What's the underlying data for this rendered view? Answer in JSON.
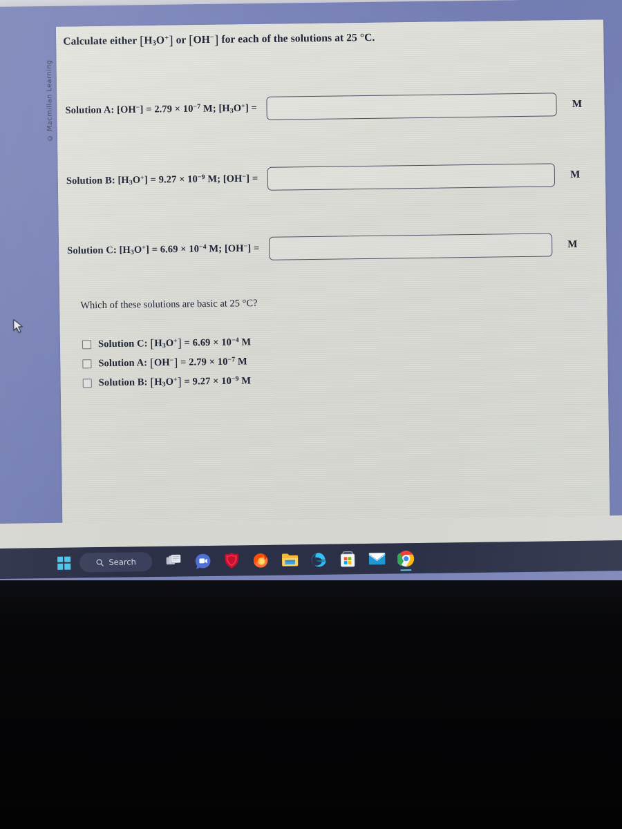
{
  "meta": {
    "copyright": "© Macmillan Learning"
  },
  "prompt": {
    "lead": "Calculate either",
    "species_1": "H3O+",
    "conjunction": "or",
    "species_2": "OH−",
    "tail": "for each of the solutions at 25 °C.",
    "full_text": "Calculate either [H3O+] or [OH−] for each of the solutions at 25 °C."
  },
  "solutions": [
    {
      "id": "A",
      "label_prefix": "Solution A:",
      "given_species": "OH−",
      "given_coefficient": "2.79",
      "given_exponent": "−7",
      "given_unit": "M",
      "asked_species": "H3O+",
      "full_label": "Solution A: [OH−] = 2.79 × 10−7 M; [H3O+] =",
      "input_value": "",
      "input_placeholder": "",
      "unit": "M"
    },
    {
      "id": "B",
      "label_prefix": "Solution B:",
      "given_species": "H3O+",
      "given_coefficient": "9.27",
      "given_exponent": "−9",
      "given_unit": "M",
      "asked_species": "OH−",
      "full_label": "Solution B: [H3O+] = 9.27 × 10−9 M; [OH−] =",
      "input_value": "",
      "input_placeholder": "",
      "unit": "M"
    },
    {
      "id": "C",
      "label_prefix": "Solution C:",
      "given_species": "H3O+",
      "given_coefficient": "6.69",
      "given_exponent": "−4",
      "given_unit": "M",
      "asked_species": "OH−",
      "full_label": "Solution C: [H3O+] = 6.69 × 10−4 M; [OH−] =",
      "input_value": "",
      "input_placeholder": "",
      "unit": "M"
    }
  ],
  "sub_question": {
    "text": "Which of these solutions are basic at 25 °C?"
  },
  "options": [
    {
      "id": "C",
      "prefix": "Solution C:",
      "species": "H3O+",
      "coefficient": "6.69",
      "exponent": "−4",
      "unit": "M",
      "checked": false,
      "full_text": "Solution C: [H3O+] = 6.69 × 10−4 M"
    },
    {
      "id": "A",
      "prefix": "Solution A:",
      "species": "OH−",
      "coefficient": "2.79",
      "exponent": "−7",
      "unit": "M",
      "checked": false,
      "full_text": "Solution A: [OH−] = 2.79 × 10−7 M"
    },
    {
      "id": "B",
      "prefix": "Solution B:",
      "species": "H3O+",
      "coefficient": "9.27",
      "exponent": "−9",
      "unit": "M",
      "checked": false,
      "full_text": "Solution B: [H3O+] = 9.27 × 10−9 M"
    }
  ],
  "taskbar": {
    "search_label": "Search",
    "items": [
      {
        "name": "start-button",
        "icon": "windows-logo-icon"
      },
      {
        "name": "search-box",
        "icon": "search-icon"
      },
      {
        "name": "task-view-button",
        "icon": "task-view-icon"
      },
      {
        "name": "google-meet-button",
        "icon": "google-meet-icon"
      },
      {
        "name": "mcafee-button",
        "icon": "mcafee-shield-icon"
      },
      {
        "name": "firefox-button",
        "icon": "firefox-icon"
      },
      {
        "name": "file-explorer-button",
        "icon": "file-explorer-icon"
      },
      {
        "name": "microsoft-edge-button",
        "icon": "edge-icon"
      },
      {
        "name": "microsoft-store-button",
        "icon": "microsoft-store-icon"
      },
      {
        "name": "mail-button",
        "icon": "mail-envelope-icon"
      },
      {
        "name": "google-chrome-button",
        "icon": "chrome-icon"
      }
    ],
    "active_app": "google-chrome-button"
  },
  "colors": {
    "desktop": "#767fb4",
    "card": "#d9dad4",
    "taskbar": "#2b3047",
    "text": "#1c2133",
    "input_border": "#4b5163",
    "accent_active": "#5fc6ea"
  }
}
